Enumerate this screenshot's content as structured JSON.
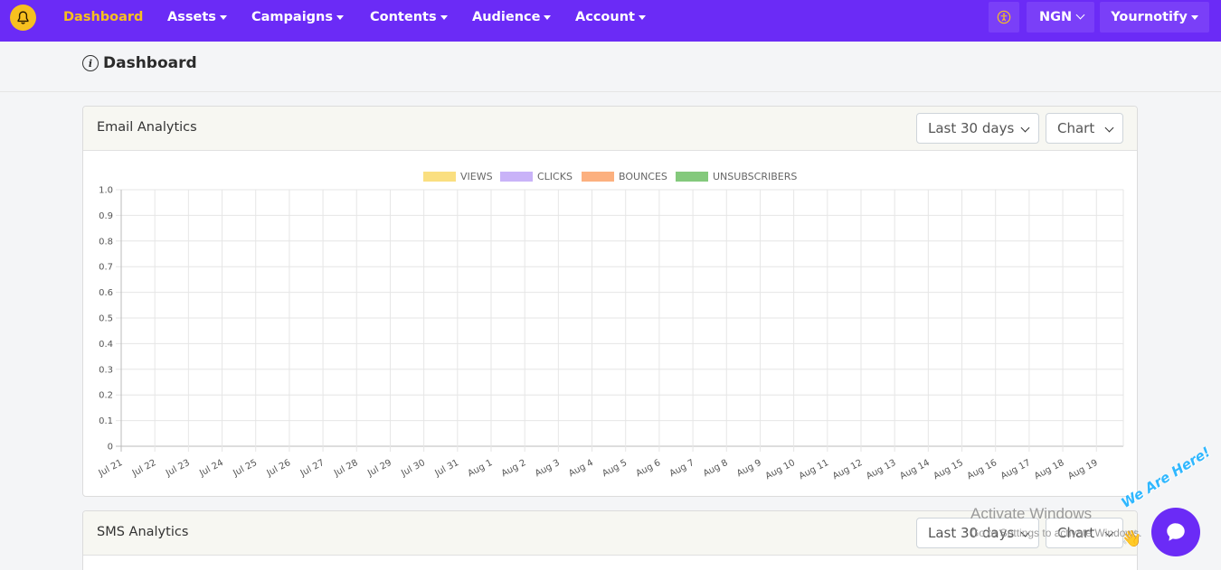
{
  "navbar": {
    "items": [
      {
        "label": "Dashboard",
        "active": true,
        "dropdown": false
      },
      {
        "label": "Assets",
        "dropdown": true
      },
      {
        "label": "Campaigns",
        "dropdown": true
      },
      {
        "label": "Contents",
        "dropdown": true
      },
      {
        "label": "Audience",
        "dropdown": true
      },
      {
        "label": "Account",
        "dropdown": true
      }
    ],
    "currency": "NGN",
    "user": "Yournotify",
    "accessibility_icon": "accessibility-icon",
    "bell_icon": "bell-icon"
  },
  "page": {
    "title": "Dashboard"
  },
  "email_card": {
    "title": "Email Analytics",
    "range_select": "Last 30 days",
    "view_select": "Chart"
  },
  "sms_card": {
    "title": "SMS Analytics",
    "range_select": "Last 30 days",
    "view_select": "Chart"
  },
  "chart_data": {
    "type": "line",
    "legend": [
      {
        "name": "VIEWS",
        "color": "#fadf80"
      },
      {
        "name": "CLICKS",
        "color": "#c9b3f8"
      },
      {
        "name": "BOUNCES",
        "color": "#fcb07f"
      },
      {
        "name": "UNSUBSCRIBERS",
        "color": "#84c97c"
      }
    ],
    "legend_position": "top-center",
    "x": [
      "Jul 21",
      "Jul 22",
      "Jul 23",
      "Jul 24",
      "Jul 25",
      "Jul 26",
      "Jul 27",
      "Jul 28",
      "Jul 29",
      "Jul 30",
      "Jul 31",
      "Aug 1",
      "Aug 2",
      "Aug 3",
      "Aug 4",
      "Aug 5",
      "Aug 6",
      "Aug 7",
      "Aug 8",
      "Aug 9",
      "Aug 10",
      "Aug 11",
      "Aug 12",
      "Aug 13",
      "Aug 14",
      "Aug 15",
      "Aug 16",
      "Aug 17",
      "Aug 18",
      "Aug 19"
    ],
    "y_ticks": [
      "1.0",
      "0.9",
      "0.8",
      "0.7",
      "0.6",
      "0.5",
      "0.4",
      "0.3",
      "0.2",
      "0.1",
      "0"
    ],
    "ylim": [
      0,
      1
    ],
    "grid": true,
    "series": []
  },
  "overlay": {
    "activate_title": "Activate Windows",
    "activate_sub": "Go to Settings to activate Windows.",
    "chat_badge": "We Are Here!"
  },
  "colors": {
    "brand": "#6b2bf6",
    "active": "#f7c01f"
  }
}
